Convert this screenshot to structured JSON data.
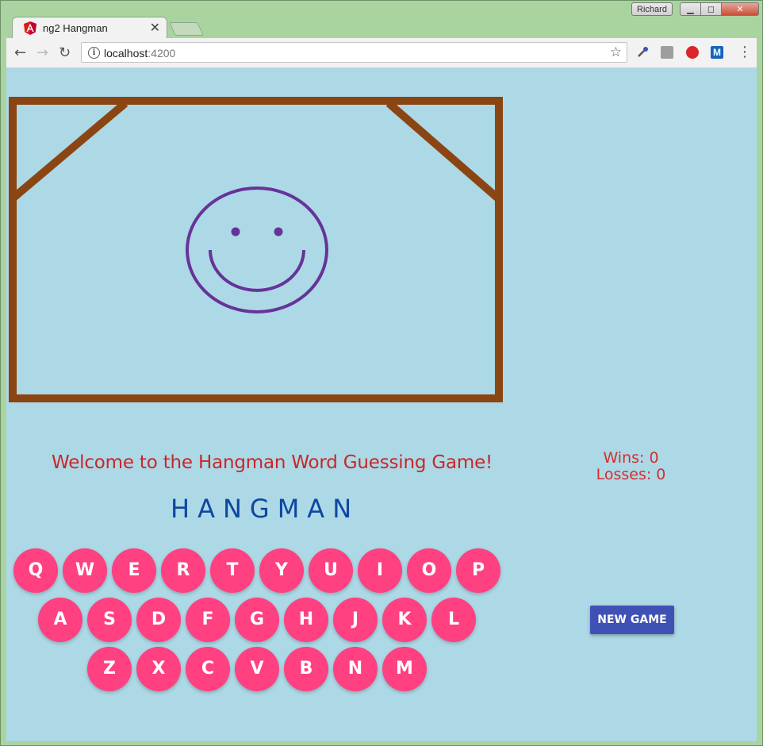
{
  "browser": {
    "tab_title": "ng2 Hangman",
    "tab_close": "✕",
    "user_name": "Richard",
    "url_host": "localhost",
    "url_port": ":4200",
    "window_controls": {
      "minimize": "▁",
      "maximize": "◻",
      "close": "✕"
    },
    "icons": {
      "back": "back-arrow-icon",
      "forward": "forward-arrow-icon",
      "reload": "reload-icon",
      "info": "info-icon",
      "star": "bookmark-star-icon",
      "menu": "kebab-menu-icon"
    }
  },
  "game": {
    "welcome_text": "Welcome to the Hangman Word Guessing Game!",
    "word_display": "HANGMAN",
    "wins_label": "Wins: 0",
    "losses_label": "Losses: 0",
    "new_game_label": "NEW GAME",
    "keyboard": {
      "row1": [
        "Q",
        "W",
        "E",
        "R",
        "T",
        "Y",
        "U",
        "I",
        "O",
        "P"
      ],
      "row2": [
        "A",
        "S",
        "D",
        "F",
        "G",
        "H",
        "J",
        "K",
        "L"
      ],
      "row3": [
        "Z",
        "X",
        "C",
        "V",
        "B",
        "N",
        "M"
      ]
    },
    "colors": {
      "background": "#add8e6",
      "gallows": "#8b4513",
      "face": "#663399",
      "key": "#ff4081",
      "welcome": "#c62828",
      "word": "#0d47a1",
      "score": "#d32f2f",
      "button": "#3f51b5"
    }
  }
}
